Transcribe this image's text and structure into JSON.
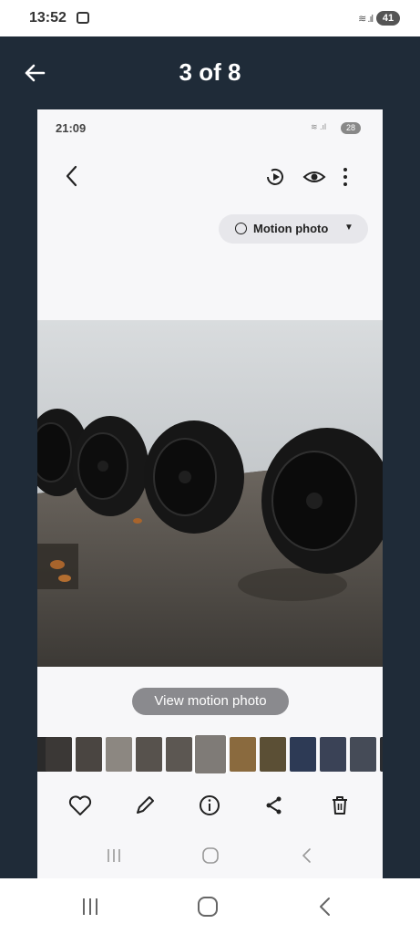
{
  "status_bar": {
    "time": "13:52",
    "signal": "≋ .ıl",
    "battery": "41"
  },
  "header": {
    "counter": "3 of 8"
  },
  "inner_screenshot": {
    "status_bar": {
      "time": "21:09",
      "signal": "≋ .ıl",
      "battery": "28"
    },
    "motion_pill": {
      "label": "Motion photo"
    },
    "view_motion_button": "View motion photo",
    "thumbnail_count": 13,
    "selected_thumbnail": 6
  },
  "colors": {
    "background": "#1f2b38",
    "accent": "#ffffff"
  }
}
